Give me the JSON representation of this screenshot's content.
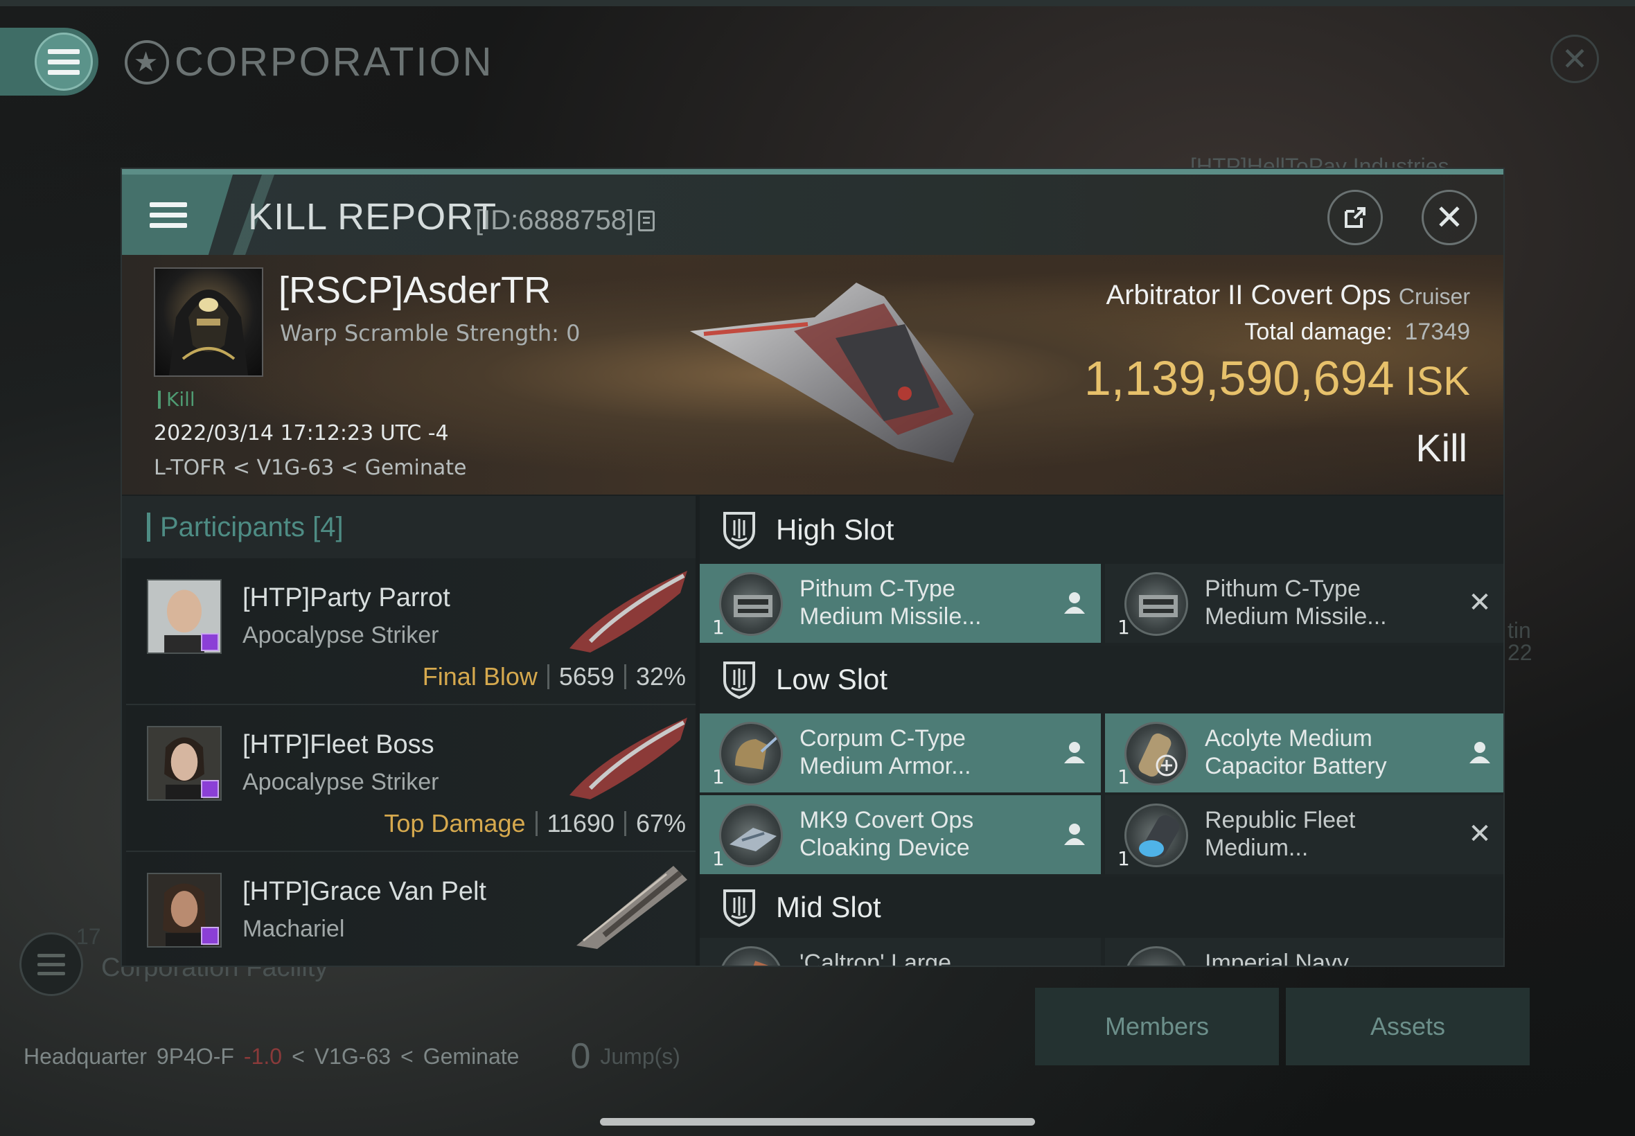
{
  "background": {
    "screen_title": "CORPORATION",
    "ghost_corp_name": "[HTP]HellToPay Industries",
    "ghost_facility": "Corporation Facility",
    "ghost_count": "17",
    "ghost_side_text": "tin",
    "ghost_side_num": "22",
    "location": {
      "label": "Headquarter",
      "system": "9P4O-F",
      "security": "-1.0",
      "constellation": "V1G-63",
      "region": "Geminate",
      "jumps": "0",
      "jumps_label": "Jump(s)"
    },
    "buttons": {
      "members": "Members",
      "assets": "Assets"
    }
  },
  "kill_report": {
    "title": "KILL REPORT",
    "id": "[ID:6888758]",
    "victim": {
      "name": "[RSCP]AsderTR",
      "warp_scramble": "Warp Scramble Strength: 0",
      "tag": "Kill",
      "timestamp": "2022/03/14 17:12:23 UTC -4",
      "location": "L-TOFR < V1G-63 < Geminate"
    },
    "ship": {
      "name": "Arbitrator II Covert Ops",
      "class": "Cruiser",
      "total_damage_label": "Total damage:",
      "total_damage": "17349",
      "isk_value": "1,139,590,694",
      "isk_unit": "ISK",
      "result": "Kill"
    },
    "participants": {
      "label": "Participants",
      "count": "[4]",
      "rows": [
        {
          "name": "[HTP]Party Parrot",
          "ship": "Apocalypse Striker",
          "role": "Final Blow",
          "damage": "5659",
          "percent": "32%"
        },
        {
          "name": "[HTP]Fleet Boss",
          "ship": "Apocalypse Striker",
          "role": "Top Damage",
          "damage": "11690",
          "percent": "67%"
        },
        {
          "name": "[HTP]Grace Van Pelt",
          "ship": "Machariel",
          "role": "",
          "damage": "",
          "percent": ""
        }
      ]
    },
    "slots": {
      "high": {
        "label": "High Slot",
        "modules": [
          {
            "line1": "Pithum C-Type",
            "line2": "Medium Missile...",
            "qty": "1",
            "state": "dropped"
          },
          {
            "line1": "Pithum C-Type",
            "line2": "Medium Missile...",
            "qty": "1",
            "state": "destroyed"
          }
        ]
      },
      "low": {
        "label": "Low Slot",
        "modules": [
          {
            "line1": "Corpum C-Type",
            "line2": "Medium Armor...",
            "qty": "1",
            "state": "dropped"
          },
          {
            "line1": "Acolyte Medium",
            "line2": "Capacitor Battery",
            "qty": "1",
            "state": "dropped"
          },
          {
            "line1": "MK9 Covert Ops",
            "line2": "Cloaking Device",
            "qty": "1",
            "state": "dropped"
          },
          {
            "line1": "Republic Fleet",
            "line2": "Medium...",
            "qty": "1",
            "state": "destroyed"
          }
        ]
      },
      "mid": {
        "label": "Mid Slot",
        "modules": [
          {
            "line1": "'Caltrop' Large",
            "qty": "",
            "state": "destroyed"
          },
          {
            "line1": "Imperial Navy",
            "qty": "",
            "state": "destroyed"
          }
        ]
      }
    }
  },
  "colors": {
    "accent": "#4e8c84",
    "dropped_bg": "#4d7c76",
    "isk": "#e7c16b",
    "role": "#d6a94e",
    "kill_tag": "#4f9b72"
  }
}
